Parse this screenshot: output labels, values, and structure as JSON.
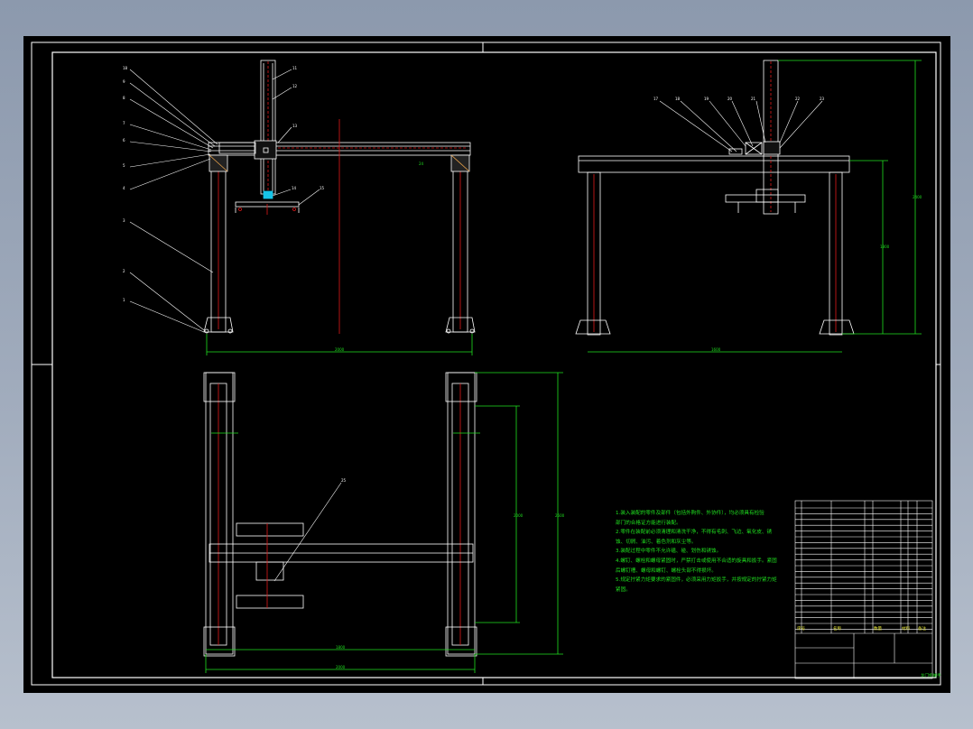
{
  "drawing": {
    "background": "#000000",
    "line_color": "#ffffff",
    "dimension_color": "#1fe01f",
    "centerline_color": "#e01818",
    "leader_color": "#ffffff",
    "highlight_color": "#16c4e8"
  },
  "notes": {
    "lines": [
      "1.装入装配的零件及部件（包括外购件、外协件），均必须具有检验",
      "部门的合格证方能进行装配。",
      "2.零件在装配前必须清理和清洗干净，不得有毛刺、飞边、氧化皮、锈",
      "蚀、切屑、油污、着色剂和灰尘等。",
      "3.装配过程中零件不允许磕、碰、划伤和锈蚀。",
      "4.螺钉、螺栓和螺母紧固时，严禁打击或使用不合适的旋具和扳手。紧固",
      "后螺钉槽、螺母和螺钉、螺栓头部不得损坏。",
      "5.规定拧紧力矩要求的紧固件，必须采用力矩扳手，并按规定的拧紧力矩",
      "紧固。"
    ]
  },
  "title_block": {
    "drawing_title": "龙门机械手",
    "header_seq": "序号",
    "header_name": "名称",
    "header_qty": "数量",
    "header_material": "材料",
    "header_remark": "备注"
  }
}
